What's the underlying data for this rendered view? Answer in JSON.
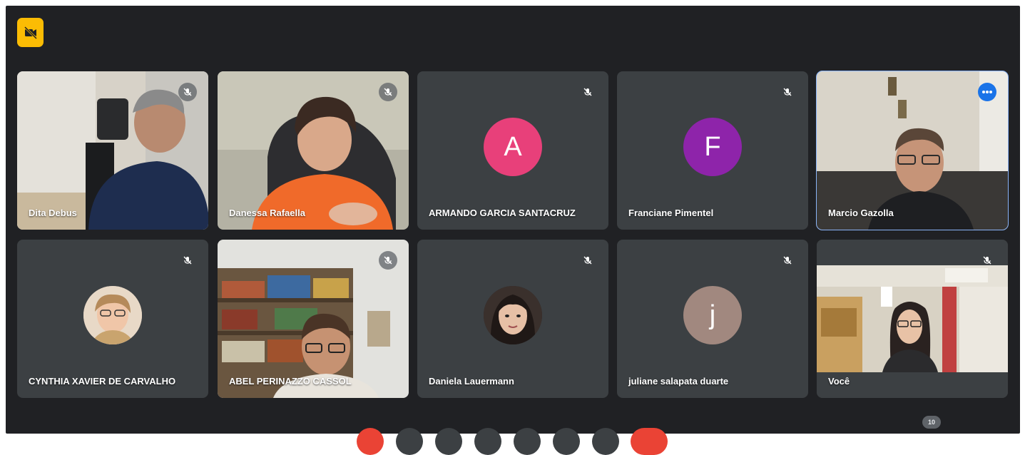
{
  "meeting": {
    "participant_count": "10",
    "you_label": "Você"
  },
  "participants": [
    {
      "name": "Dita Debus",
      "tile": "video",
      "mic": "muted"
    },
    {
      "name": "Danessa Rafaella",
      "tile": "video",
      "mic": "muted"
    },
    {
      "name": "ARMANDO GARCIA SANTACRUZ",
      "tile": "avatar",
      "initial": "A",
      "avatar_color": "#e8407a",
      "mic": "muted"
    },
    {
      "name": "Franciane Pimentel",
      "tile": "avatar",
      "initial": "F",
      "avatar_color": "#8e24aa",
      "mic": "muted"
    },
    {
      "name": "Marcio Gazolla",
      "tile": "video",
      "mic": "speaking",
      "highlighted": true
    },
    {
      "name": "CYNTHIA XAVIER DE CARVALHO",
      "tile": "photo-avatar",
      "mic": "muted"
    },
    {
      "name": "ABEL PERINAZZO CASSOL",
      "tile": "video",
      "mic": "muted"
    },
    {
      "name": "Daniela Lauermann",
      "tile": "photo-avatar",
      "mic": "muted"
    },
    {
      "name": "juliane salapata duarte",
      "tile": "avatar",
      "initial": "j",
      "avatar_color": "#a1887f",
      "mic": "muted"
    },
    {
      "name": "Você",
      "tile": "video",
      "mic": "muted"
    }
  ],
  "icons": {
    "top_badge": "camera-off-icon",
    "mic": "mic-off-icon",
    "speaking": "more-dots-icon"
  },
  "colors": {
    "background": "#202124",
    "tile": "#3c4043",
    "highlight": "#8ab4f8",
    "badge": "#fbbc04",
    "end_call": "#ea4335"
  }
}
